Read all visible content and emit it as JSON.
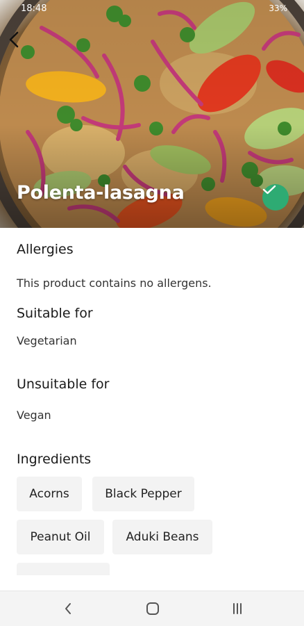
{
  "status_bar": {
    "time": "18:48",
    "right_text": "33%"
  },
  "hero": {
    "title": "Polenta-lasagna",
    "back_icon": "chevron-left-icon",
    "badge_icon": "check-icon",
    "badge_color": "#2eab73"
  },
  "sections": {
    "allergies": {
      "title": "Allergies",
      "text": "This product contains no allergens."
    },
    "suitable": {
      "title": "Suitable for",
      "text": "Vegetarian"
    },
    "unsuitable": {
      "title": "Unsuitable for",
      "text": "Vegan"
    },
    "ingredients": {
      "title": "Ingredients",
      "items": [
        "Acorns",
        "Black Pepper",
        "Peanut Oil",
        "Aduki Beans"
      ]
    }
  },
  "nav_bar": {
    "back": "back-icon",
    "home": "home-icon",
    "recents": "recents-icon"
  }
}
